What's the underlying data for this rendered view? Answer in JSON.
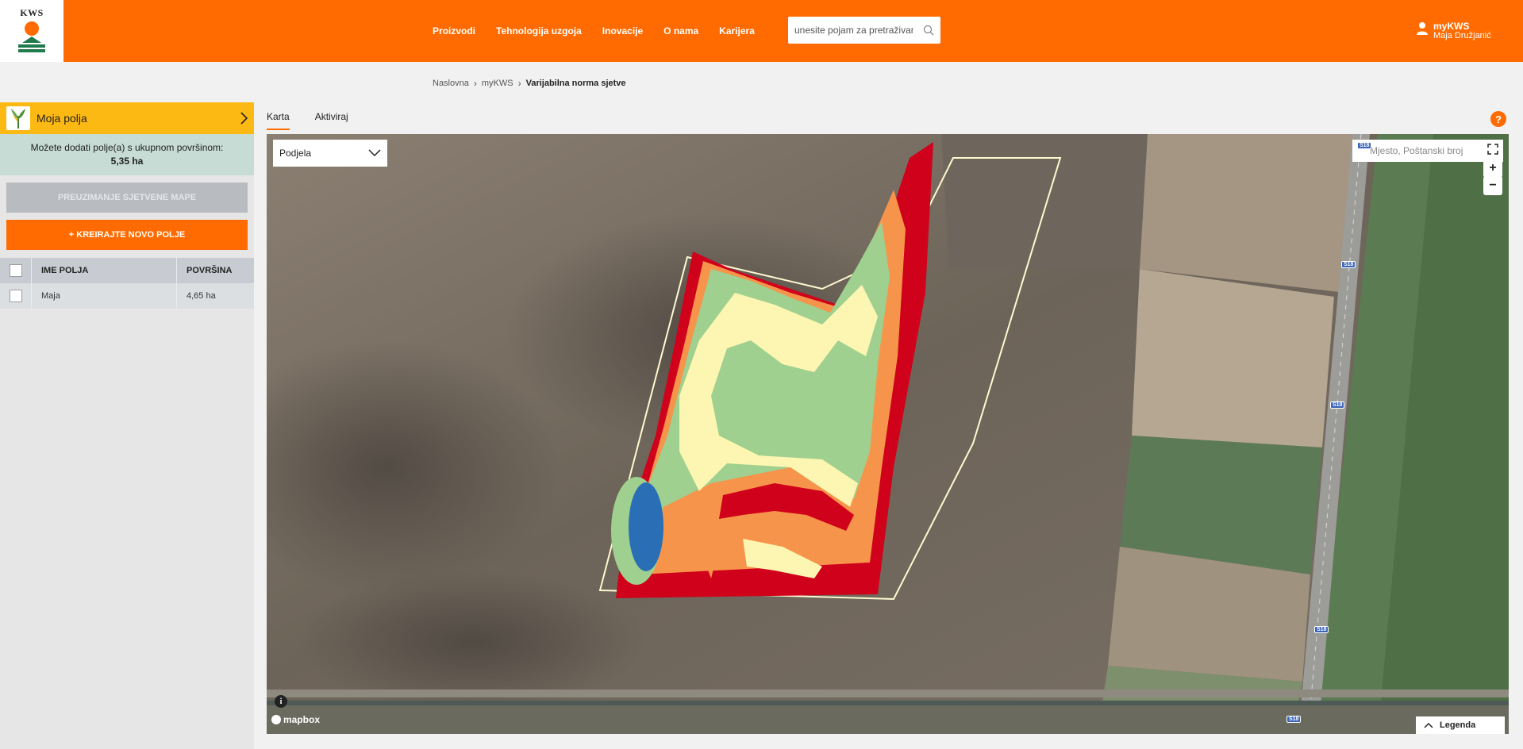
{
  "header": {
    "logo_text": "KWS",
    "nav": [
      "Proizvodi",
      "Tehnologija uzgoja",
      "Inovacije",
      "O nama",
      "Karijera"
    ],
    "search_placeholder": "unesite pojam za pretraživanje",
    "user": {
      "title": "myKWS",
      "name": "Maja Družjanić"
    }
  },
  "breadcrumb": {
    "home": "Naslovna",
    "mykws": "myKWS",
    "current": "Varijabilna norma sjetve"
  },
  "sidebar": {
    "title": "Moja polja",
    "info_text": "Možete dodati polje(a) s ukupnom površinom:",
    "info_area": "5,35 ha",
    "download_button": "PREUZIMANJE SJETVENE MAPE",
    "create_button": "+ KREIRAJTE NOVO POLJE",
    "table": {
      "headers": [
        "IME POLJA",
        "POVRŠINA"
      ],
      "rows": [
        {
          "name": "Maja",
          "area": "4,65 ha"
        }
      ]
    }
  },
  "tabs": [
    "Karta",
    "Aktiviraj"
  ],
  "map": {
    "dropdown_value": "Podjela",
    "search_placeholder": "Mjesto, Poštanski broj",
    "zoom_in": "+",
    "zoom_out": "−",
    "info": "i",
    "attribution": "mapbox",
    "legend_label": "Legenda",
    "road_label": "S18"
  },
  "colors": {
    "brand_orange": "#ff6b00",
    "sidebar_yellow": "#fdb913",
    "zone_red": "#d0021b",
    "zone_orange": "#f7944b",
    "zone_yellow": "#fdf6b2",
    "zone_green": "#9fd08f",
    "zone_blue": "#2a6fb5"
  }
}
